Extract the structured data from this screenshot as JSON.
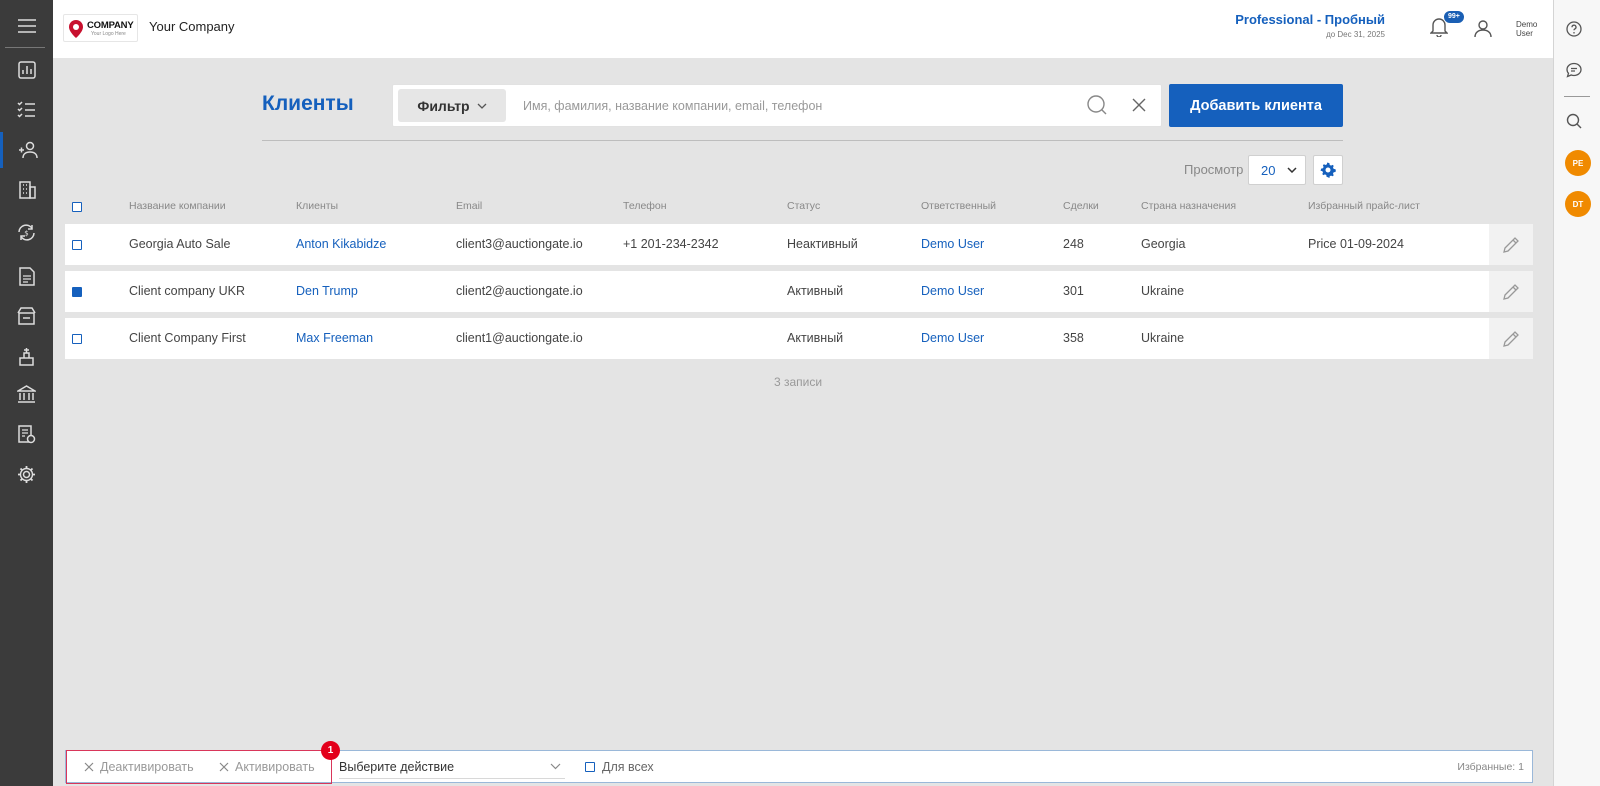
{
  "header": {
    "logo_text": "COMPANY",
    "logo_subtext": "Your Logo Here",
    "company_name": "Your Company",
    "plan_name": "Professional - Пробный",
    "plan_until": "до Dec 31, 2025",
    "notifications_badge": "99+",
    "user_name": "Demo User"
  },
  "sidebar": {
    "items": [
      {
        "icon": "menu-icon"
      },
      {
        "icon": "dashboard-chart-icon"
      },
      {
        "icon": "list-checks-icon"
      },
      {
        "icon": "clients-icon",
        "active": true
      },
      {
        "icon": "building-icon"
      },
      {
        "icon": "exchange-icon"
      },
      {
        "icon": "document-icon"
      },
      {
        "icon": "warehouse-icon"
      },
      {
        "icon": "auction-icon"
      },
      {
        "icon": "bank-icon"
      },
      {
        "icon": "report-icon"
      },
      {
        "icon": "gear-icon"
      }
    ]
  },
  "right_bar": {
    "icons": [
      "help-icon",
      "chat-icon",
      "search-icon"
    ],
    "avatars": [
      "PE",
      "DT"
    ]
  },
  "main": {
    "title": "Клиенты",
    "filter_label": "Фильтр",
    "search_placeholder": "Имя, фамилия, название компании, email, телефон",
    "add_button": "Добавить клиента",
    "view_label": "Просмотр",
    "page_size": "20"
  },
  "table": {
    "columns": [
      "Название компании",
      "Клиенты",
      "Email",
      "Телефон",
      "Статус",
      "Ответственный",
      "Сделки",
      "Страна назначения",
      "Избранный прайс-лист"
    ],
    "rows": [
      {
        "checked": false,
        "company": "Georgia Auto Sale",
        "client": "Anton Kikabidze",
        "email": "client3@auctiongate.io",
        "phone": "+1 201-234-2342",
        "status": "Неактивный",
        "manager": "Demo User",
        "deals": "248",
        "country": "Georgia",
        "pricelist": "Price 01-09-2024"
      },
      {
        "checked": true,
        "company": "Client company UKR",
        "client": "Den Trump",
        "email": "client2@auctiongate.io",
        "phone": "",
        "status": "Активный",
        "manager": "Demo User",
        "deals": "301",
        "country": "Ukraine",
        "pricelist": ""
      },
      {
        "checked": false,
        "company": "Client Company First",
        "client": "Max Freeman",
        "email": "client1@auctiongate.io",
        "phone": "",
        "status": "Активный",
        "manager": "Demo User",
        "deals": "358",
        "country": "Ukraine",
        "pricelist": ""
      }
    ],
    "records_text": "3 записи"
  },
  "bottom_bar": {
    "deactivate": "Деактивировать",
    "activate": "Активировать",
    "selected_count": "1",
    "action_placeholder": "Выберите действие",
    "for_all": "Для всех",
    "favorites": "Избранные: 1"
  },
  "colors": {
    "accent": "#1560bd",
    "sidebar": "#3b3b3b",
    "badge": "#e3001b",
    "avatar": "#f08a00"
  }
}
